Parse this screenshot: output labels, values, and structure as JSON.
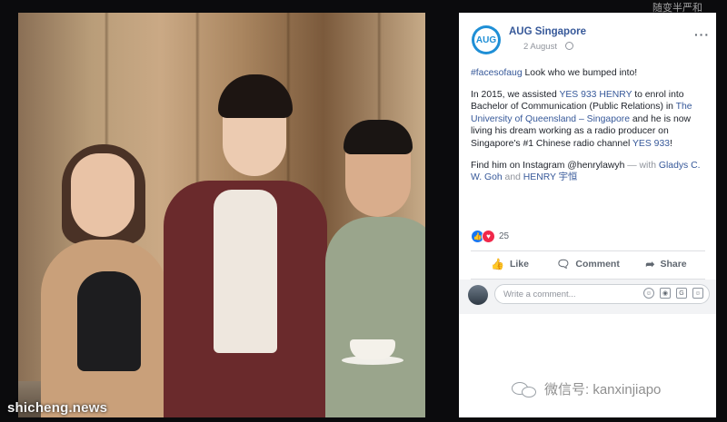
{
  "page": {
    "name": "AUG Singapore",
    "date": "2 August",
    "avatar_text": "AUG"
  },
  "post": {
    "hashtag": "#facesofaug",
    "line1_rest": " Look who we bumped into!",
    "p2_a": "In 2015, we assisted ",
    "p2_link1": "YES 933 HENRY",
    "p2_b": " to enrol into Bachelor of Communication (Public Relations) in ",
    "p2_link2": "The University of Queensland – Singapore",
    "p2_c": " and he is now living his dream working as a radio producer on Singapore's #1 Chinese radio channel ",
    "p2_link3": "YES 933",
    "p2_d": "!",
    "p3_a": "Find him on Instagram @henrylawyh",
    "p3_b": " — with ",
    "p3_link1": "Gladys C. W. Goh",
    "p3_c": " and ",
    "p3_link2": "HENRY 宇恒"
  },
  "reactions": {
    "count": "25",
    "like_icon": "thumbs-up-icon",
    "love_icon": "heart-icon"
  },
  "actions": {
    "like": "Like",
    "comment": "Comment",
    "share": "Share"
  },
  "comment_box": {
    "placeholder": "Write a comment..."
  },
  "watermarks": {
    "left": "shicheng.news",
    "wechat": "微信号: kanxinjiapo",
    "top_right": "随变半严和"
  },
  "colors": {
    "fb_link": "#365899",
    "like_blue": "#1877f2",
    "love_red": "#f0284a",
    "avatar_blue": "#1f8fd6"
  }
}
